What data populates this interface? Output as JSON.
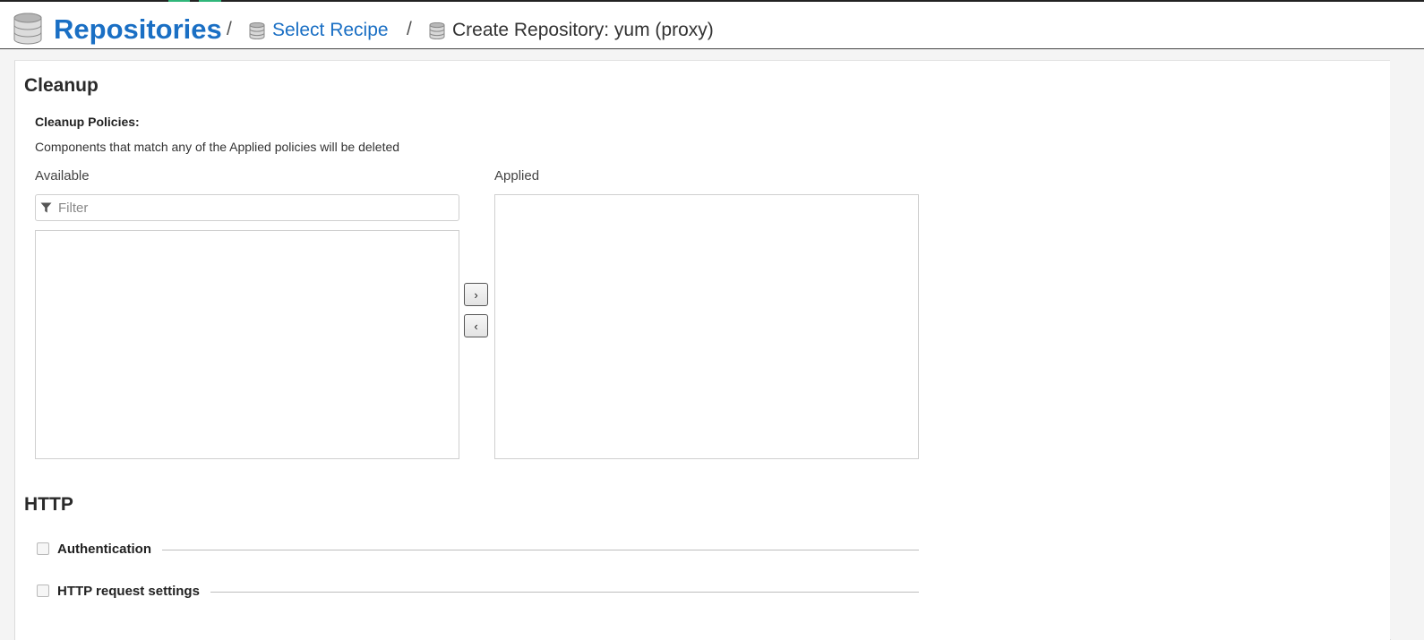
{
  "header": {
    "title": "Repositories",
    "separator": "/",
    "crumb_select_recipe": "Select Recipe",
    "crumb_current": "Create Repository: yum (proxy)",
    "icons": [
      "database-icon"
    ]
  },
  "cleanup": {
    "section_title": "Cleanup",
    "policies_label": "Cleanup Policies:",
    "help_text": "Components that match any of the Applied policies will be deleted",
    "available_label": "Available",
    "applied_label": "Applied",
    "filter_placeholder": "Filter",
    "filter_value": "",
    "available_items": [],
    "applied_items": [],
    "move_right_glyph": "›",
    "move_left_glyph": "‹"
  },
  "http": {
    "section_title": "HTTP",
    "authentication_label": "Authentication",
    "authentication_checked": false,
    "request_settings_label": "HTTP request settings",
    "request_settings_checked": false
  },
  "colors": {
    "link_blue": "#1a6fc4",
    "accent_green": "#2fb67a"
  }
}
